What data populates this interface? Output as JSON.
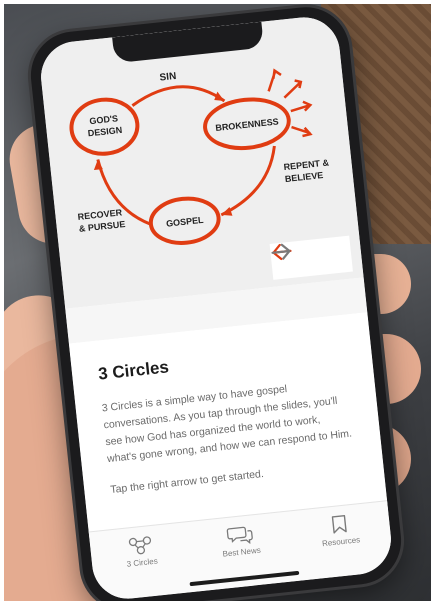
{
  "diagram": {
    "top_label": "SIN",
    "circle_left": [
      "GOD'S",
      "DESIGN"
    ],
    "circle_right": "BROKENNESS",
    "circle_bottom": "GOSPEL",
    "label_right": [
      "REPENT &",
      "BELIEVE"
    ],
    "label_left": [
      "RECOVER",
      "& PURSUE"
    ]
  },
  "colors": {
    "accent": "#e03c12",
    "arrow_inactive": "#7a7a7a"
  },
  "nav": {
    "prev_icon": "arrow-left-icon",
    "next_icon": "arrow-right-icon"
  },
  "content": {
    "title": "3 Circles",
    "paragraph": "3 Circles is a simple way to have gospel conversations. As you tap through the slides, you'll see how God has organized the world to work, what's gone wrong, and how we can respond to Him.",
    "instruction": "Tap the right arrow to get started."
  },
  "tabs": [
    {
      "label": "3 Circles",
      "icon": "circles-network-icon"
    },
    {
      "label": "Best News",
      "icon": "chat-bubbles-icon"
    },
    {
      "label": "Resources",
      "icon": "bookmark-icon"
    }
  ]
}
